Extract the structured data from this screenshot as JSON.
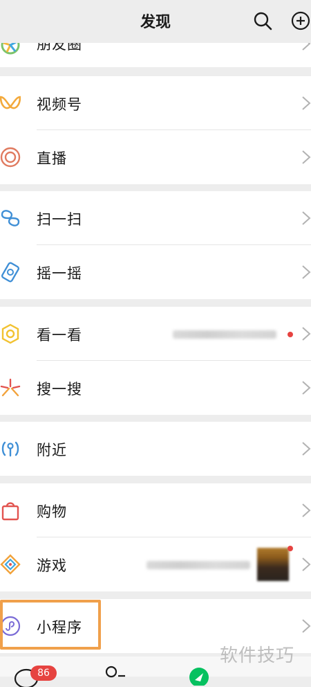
{
  "header": {
    "title": "发现"
  },
  "groups": {
    "moments_partial_label": "朋友圈",
    "channels_label": "视频号",
    "live_label": "直播",
    "scan_label": "扫一扫",
    "shake_label": "摇一摇",
    "top_stories_label": "看一看",
    "search_label": "搜一搜",
    "nearby_label": "附近",
    "shopping_label": "购物",
    "games_label": "游戏",
    "mini_programs_label": "小程序"
  },
  "tabbar": {
    "chats_badge": "86"
  },
  "watermark": "软件技巧",
  "colors": {
    "accent_highlight": "#f0a04b",
    "badge_red": "#e64340",
    "page_bg": "#ededed",
    "wechat_green": "#07c160"
  }
}
